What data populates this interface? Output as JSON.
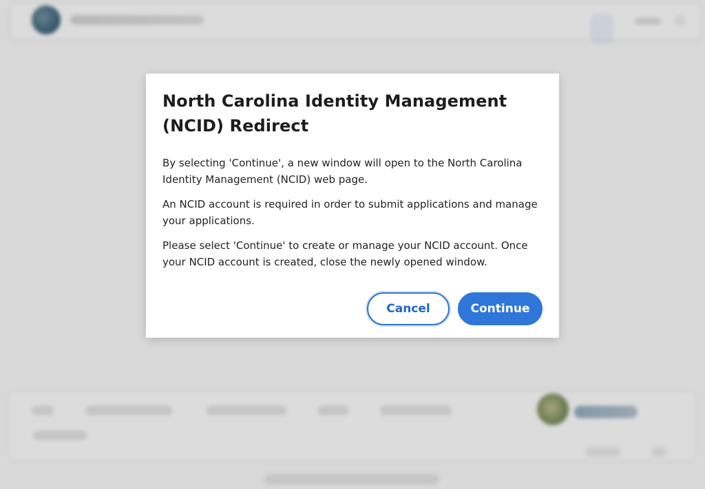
{
  "modal": {
    "title": "North Carolina Identity Management (NCID) Redirect",
    "paragraphs": [
      "By selecting 'Continue', a new window will open to the North Carolina Identity Management (NCID) web page.",
      "An NCID account is required in order to submit applications and manage your applications.",
      "Please select 'Continue' to create or manage your NCID account. Once your NCID account is created, close the newly opened window."
    ],
    "buttons": {
      "cancel": "Cancel",
      "continue": "Continue"
    }
  },
  "colors": {
    "primary": "#2f76d9",
    "primary_text": "#1f66c2",
    "overlay": "#00000014",
    "modal_bg": "#ffffff",
    "page_bg": "#ececec"
  }
}
